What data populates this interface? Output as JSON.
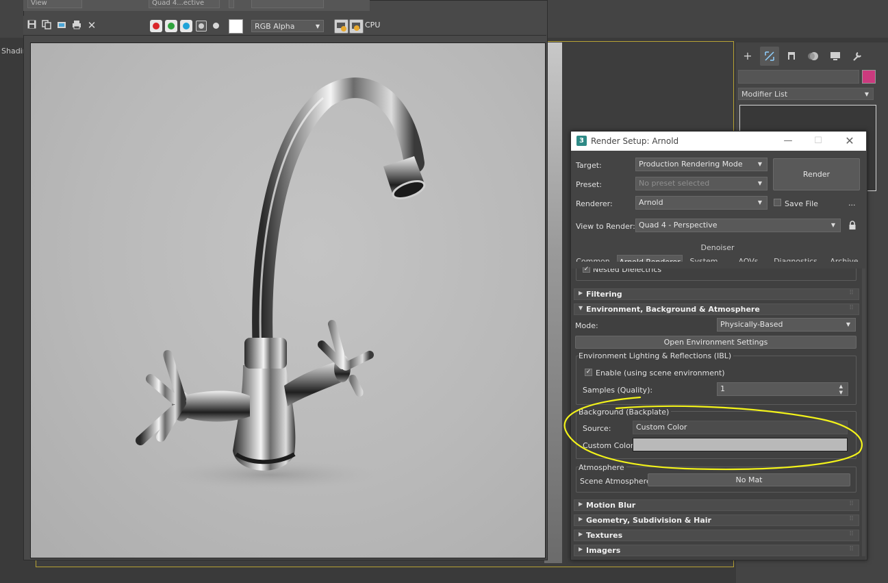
{
  "viewport": {
    "shading_label": "Shadin"
  },
  "frame_buffer": {
    "toolbar_top": {
      "view_dropdown": "View",
      "viewport_dropdown": "Quad 4...ective"
    },
    "channel_dropdown": "RGB Alpha",
    "cpu_label": "CPU",
    "channels": [
      {
        "name": "red",
        "color": "#d9262a"
      },
      {
        "name": "green",
        "color": "#2ea33c"
      },
      {
        "name": "blue",
        "color": "#20a4d8"
      }
    ]
  },
  "command_panel": {
    "modifier_list": "Modifier List",
    "object_color": "#cc3a7e"
  },
  "render_setup": {
    "title": "Render Setup: Arnold",
    "target_label": "Target:",
    "target_value": "Production Rendering Mode",
    "preset_label": "Preset:",
    "preset_value": "No preset selected",
    "renderer_label": "Renderer:",
    "renderer_value": "Arnold",
    "save_file_label": "Save File",
    "ellipsis": "...",
    "view_to_render_label": "View to Render:",
    "view_to_render_value": "Quad 4 - Perspective",
    "render_button": "Render",
    "tabs_row1": [
      "Denoiser"
    ],
    "tabs_row2": [
      "Common",
      "Arnold Renderer",
      "System",
      "AOVs",
      "Diagnostics",
      "Archive"
    ],
    "nested_dielectrics": "Nested Dielectrics",
    "rollouts": {
      "filtering": "Filtering",
      "environment": "Environment, Background & Atmosphere",
      "motion_blur": "Motion Blur",
      "geometry": "Geometry, Subdivision & Hair",
      "textures": "Textures",
      "imagers": "Imagers"
    },
    "environment": {
      "mode_label": "Mode:",
      "mode_value": "Physically-Based",
      "open_env_button": "Open Environment Settings",
      "ibl_group": "Environment Lighting & Reflections (IBL)",
      "enable_label": "Enable (using scene environment)",
      "samples_label": "Samples (Quality):",
      "samples_value": "1",
      "background_group": "Background (Backplate)",
      "source_label": "Source:",
      "source_value": "Custom Color",
      "custom_color_label": "Custom Color:",
      "custom_color": "#b9b9b9",
      "atmosphere_group": "Atmosphere",
      "scene_atmosphere_label": "Scene Atmosphere:",
      "scene_atmosphere_value": "No Mat"
    }
  },
  "annotation": {
    "highlight_color": "#f3f31a"
  }
}
